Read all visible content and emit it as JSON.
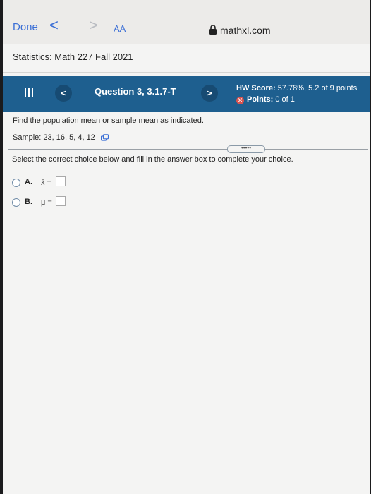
{
  "browser": {
    "done_label": "Done",
    "back_glyph": "<",
    "forward_glyph": ">",
    "text_size_label": "AA",
    "url": "mathxl.com",
    "accent_color": "#3b6fd6"
  },
  "course": {
    "title": "Statistics: Math 227 Fall 2021"
  },
  "question_bar": {
    "prev_glyph": "<",
    "next_glyph": ">",
    "question_title": "Question 3, 3.1.7-T",
    "hw_score_label": "HW Score:",
    "hw_score_value": "57.78%, 5.2 of 9 points",
    "points_label": "Points:",
    "points_value": "0 of 1",
    "bar_color": "#1e5f8f"
  },
  "question": {
    "prompt": "Find the population mean or sample mean as indicated.",
    "sample": "Sample: 23, 16, 5, 4, 12",
    "more_glyph": "•••••",
    "instruction": "Select the correct choice below and fill in the answer box to complete your choice."
  },
  "choices": [
    {
      "letter": "A.",
      "symbol": "x̄ ="
    },
    {
      "letter": "B.",
      "symbol": "μ ="
    }
  ]
}
